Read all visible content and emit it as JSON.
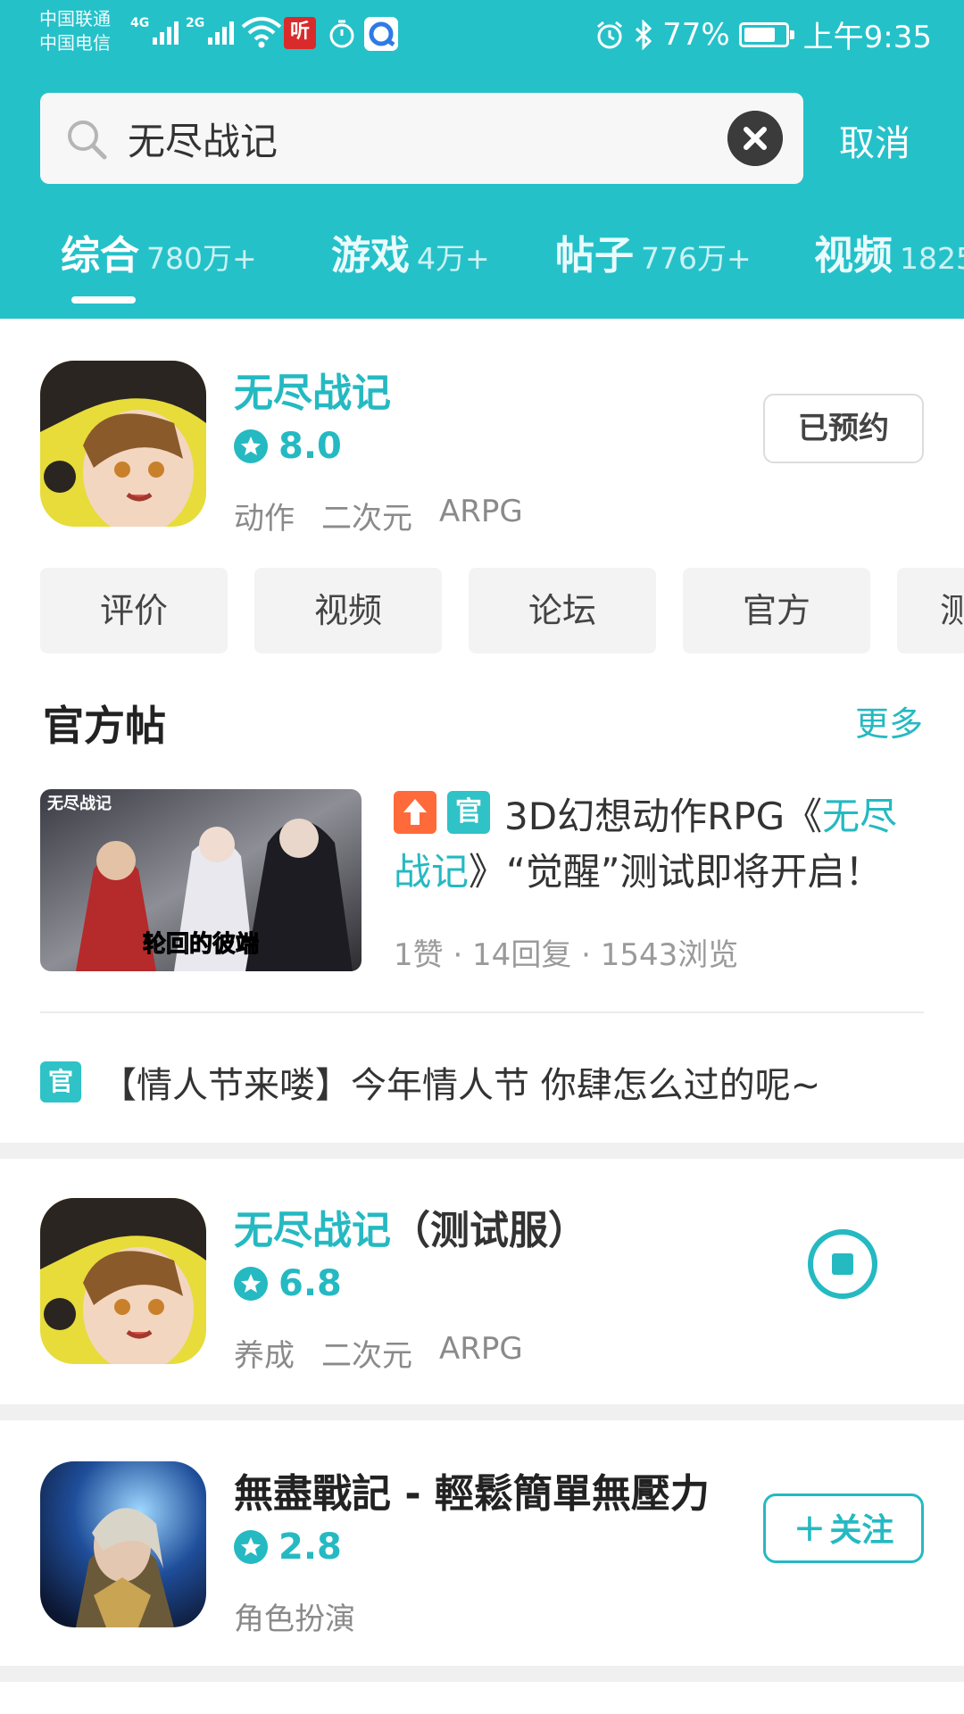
{
  "status_bar": {
    "carrier_1": "中国联通",
    "carrier_2": "中国电信",
    "net_1": "4G",
    "net_2": "2G",
    "app_icon_text": "听",
    "battery_percent": "77%",
    "battery_level": 0.77,
    "time": "上午9:35"
  },
  "search": {
    "query": "无尽战记",
    "cancel_label": "取消"
  },
  "tabs": [
    {
      "label": "综合",
      "count": "780万+"
    },
    {
      "label": "游戏",
      "count": "4万+"
    },
    {
      "label": "帖子",
      "count": "776万+"
    },
    {
      "label": "视频",
      "count": "1825"
    }
  ],
  "colors": {
    "accent": "#25c1c9",
    "accent_text": "#25b9c2",
    "upvote_badge": "#ff6a3a"
  },
  "card_1": {
    "title": "无尽战记",
    "rating": "8.0",
    "tags": [
      "动作",
      "二次元",
      "ARPG"
    ],
    "action_label": "已预约",
    "chips": [
      "评价",
      "视频",
      "论坛",
      "官方",
      "测"
    ],
    "section_title": "官方帖",
    "more_label": "更多",
    "post": {
      "thumb_caption": "无尽战记",
      "thumb_subcaption": "轮回的彼端",
      "badge_guan": "官",
      "title_prefix": "3D幻想动作RPG《",
      "title_highlight": "无尽战记",
      "title_suffix": "》“觉醒”测试即将开启！",
      "meta": "1赞 · 14回复 · 1543浏览"
    },
    "notice": {
      "badge": "官",
      "text": "【情人节来喽】今年情人节 你肆怎么过的呢~"
    }
  },
  "card_2": {
    "title": "无尽战记",
    "title_suffix": "（测试服）",
    "rating": "6.8",
    "tags": [
      "养成",
      "二次元",
      "ARPG"
    ],
    "action_icon": "pause-download-icon"
  },
  "card_3": {
    "title": "無盡戰記 - 輕鬆簡單無壓力",
    "rating": "2.8",
    "tags": [
      "角色扮演"
    ],
    "action_label": "关注",
    "action_icon": "plus-icon"
  }
}
